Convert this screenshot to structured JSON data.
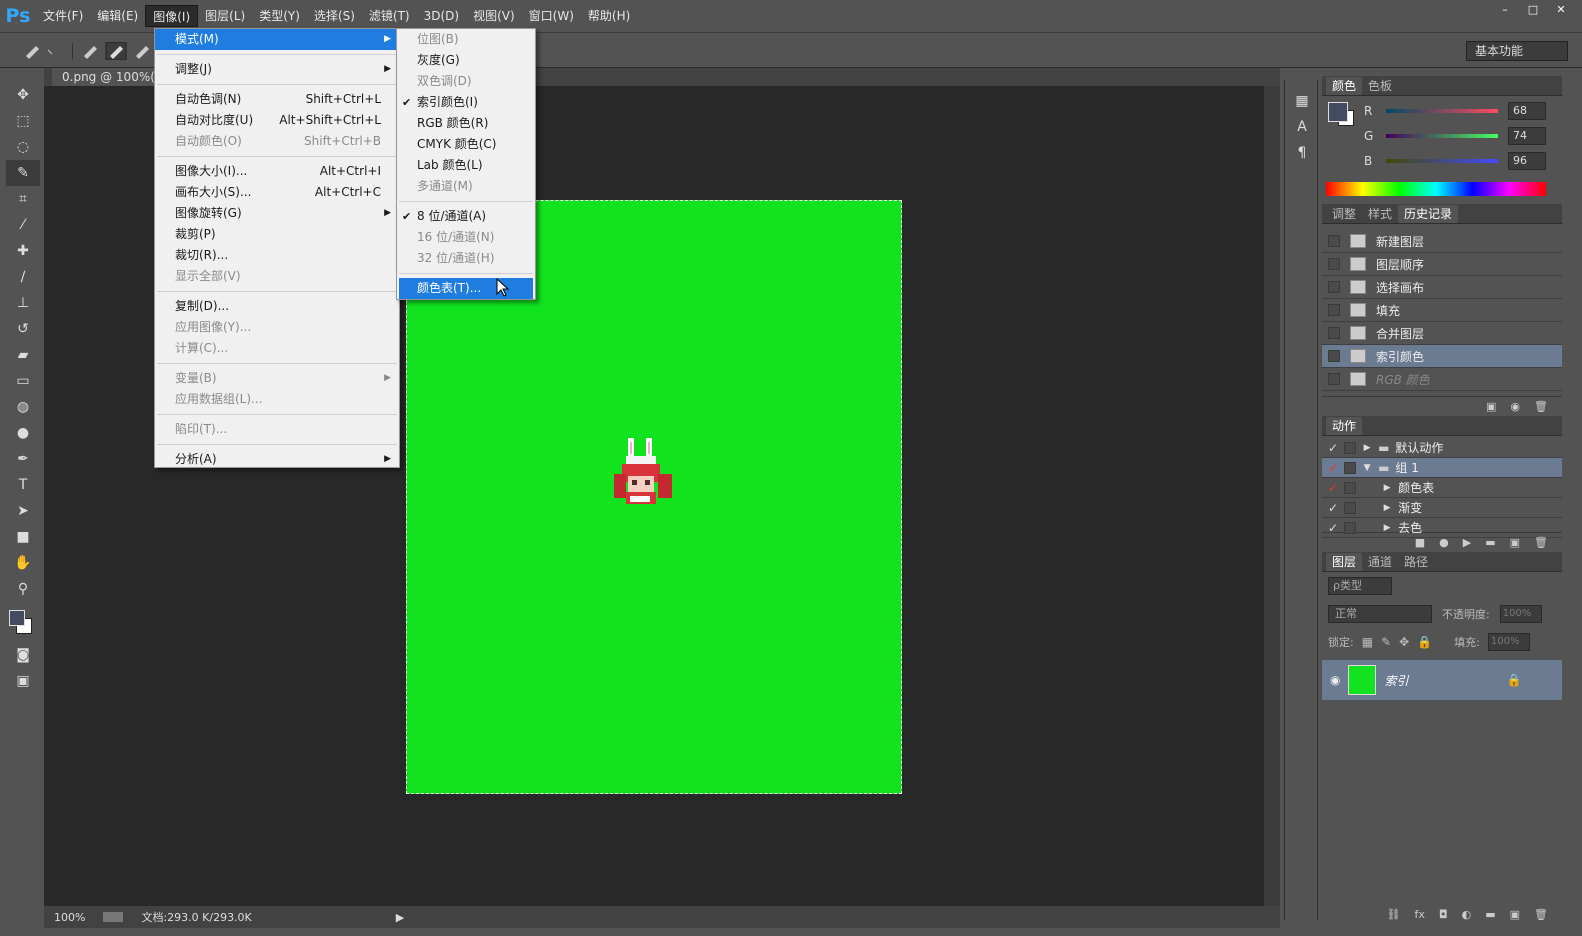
{
  "app": {
    "logo": "Ps"
  },
  "menubar": [
    "文件(F)",
    "编辑(E)",
    "图像(I)",
    "图层(L)",
    "类型(Y)",
    "选择(S)",
    "滤镜(T)",
    "3D(D)",
    "视图(V)",
    "窗口(W)",
    "帮助(H)"
  ],
  "menubar_active": "图像(I)",
  "window_controls": [
    "–",
    "□",
    "✕"
  ],
  "workspace": "基本功能",
  "document": {
    "tab": "0.png @ 100%(索引",
    "canvas_color": "#11e31e"
  },
  "status": {
    "zoom": "100%",
    "doc": "文档:293.0 K/293.0K"
  },
  "image_menu": {
    "mode": "模式(M)",
    "adjust": "调整(J)",
    "auto_tone": {
      "label": "自动色调(N)",
      "shortcut": "Shift+Ctrl+L"
    },
    "auto_contrast": {
      "label": "自动对比度(U)",
      "shortcut": "Alt+Shift+Ctrl+L"
    },
    "auto_color": {
      "label": "自动颜色(O)",
      "shortcut": "Shift+Ctrl+B"
    },
    "image_size": {
      "label": "图像大小(I)...",
      "shortcut": "Alt+Ctrl+I"
    },
    "canvas_size": {
      "label": "画布大小(S)...",
      "shortcut": "Alt+Ctrl+C"
    },
    "rotation": "图像旋转(G)",
    "crop": "裁剪(P)",
    "trim": "裁切(R)...",
    "reveal_all": "显示全部(V)",
    "duplicate": "复制(D)...",
    "apply_image": "应用图像(Y)...",
    "calculations": "计算(C)...",
    "variables": "变量(B)",
    "apply_data": "应用数据组(L)...",
    "trap": "陷印(T)...",
    "analysis": "分析(A)"
  },
  "mode_submenu": {
    "bitmap": "位图(B)",
    "grayscale": "灰度(G)",
    "duotone": "双色调(D)",
    "indexed": "索引颜色(I)",
    "rgb": "RGB 颜色(R)",
    "cmyk": "CMYK 颜色(C)",
    "lab": "Lab 颜色(L)",
    "multichannel": "多通道(M)",
    "bit8": "8 位/通道(A)",
    "bit16": "16 位/通道(N)",
    "bit32": "32 位/通道(H)",
    "color_table": "颜色表(T)..."
  },
  "color_panel": {
    "tabs": [
      "颜色",
      "色板"
    ],
    "r": {
      "label": "R",
      "value": "68"
    },
    "g": {
      "label": "G",
      "value": "74"
    },
    "b": {
      "label": "B",
      "value": "96"
    },
    "fg_color": "#444a60"
  },
  "history_panel": {
    "tabs": [
      "调整",
      "样式",
      "历史记录"
    ],
    "items": [
      "新建图层",
      "图层顺序",
      "选择画布",
      "填充",
      "合并图层",
      "索引颜色",
      "RGB 颜色"
    ]
  },
  "actions_panel": {
    "title": "动作",
    "items": [
      "默认动作",
      "组 1",
      "颜色表",
      "渐变",
      "去色"
    ]
  },
  "layers_panel": {
    "tabs": [
      "图层",
      "通道",
      "路径"
    ],
    "filter": "ρ类型",
    "blend": "正常",
    "opacity_label": "不透明度:",
    "opacity": "100%",
    "lock_label": "锁定:",
    "fill_label": "填充:",
    "fill": "100%",
    "layer_name": "索引"
  }
}
